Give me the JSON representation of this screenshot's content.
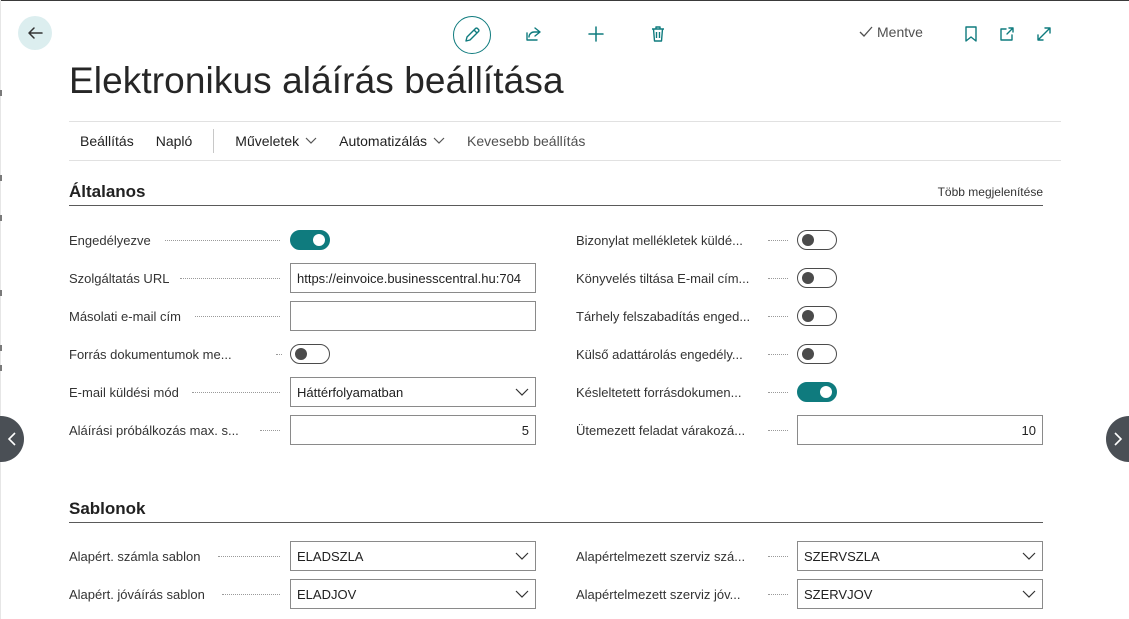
{
  "page": {
    "title": "Elektronikus aláírás beállítása"
  },
  "action_bar": {
    "saved_label": "Mentve",
    "icons": [
      "back-arrow-icon",
      "edit-pencil-icon",
      "share-icon",
      "plus-icon",
      "trash-icon",
      "checkmark-icon",
      "bookmark-icon",
      "open-new-window-icon",
      "expand-icon"
    ]
  },
  "menu": {
    "items": [
      {
        "label": "Beállítás"
      },
      {
        "label": "Napló"
      },
      {
        "label": "Műveletek"
      },
      {
        "label": "Automatizálás"
      },
      {
        "label": "Kevesebb beállítás"
      }
    ]
  },
  "general": {
    "title": "Általanos",
    "show_more": "Több megjelenítése",
    "left_fields": [
      {
        "label": "Engedélyezve",
        "type": "toggle",
        "value": true
      },
      {
        "label": "Szolgáltatás URL",
        "type": "text",
        "value": "https://einvoice.businesscentral.hu:704"
      },
      {
        "label": "Másolati e-mail cím",
        "type": "text",
        "value": ""
      },
      {
        "label": "Forrás dokumentumok me...",
        "type": "toggle",
        "value": false
      },
      {
        "label": "E-mail küldési mód",
        "type": "select",
        "value": "Háttérfolyamatban"
      },
      {
        "label": "Aláírási próbálkozás max. s...",
        "type": "number",
        "value": "5"
      }
    ],
    "right_fields": [
      {
        "label": "Bizonylat mellékletek küldé...",
        "type": "toggle",
        "value": false
      },
      {
        "label": "Könyvelés tiltása E-mail cím...",
        "type": "toggle",
        "value": false
      },
      {
        "label": "Tárhely felszabadítás enged...",
        "type": "toggle",
        "value": false
      },
      {
        "label": "Külső adattárolás engedély...",
        "type": "toggle",
        "value": false
      },
      {
        "label": "Késleltetett forrásdokumen...",
        "type": "toggle",
        "value": true
      },
      {
        "label": "Ütemezett feladat várakozá...",
        "type": "number",
        "value": "10"
      }
    ]
  },
  "templates": {
    "title": "Sablonok",
    "left_fields": [
      {
        "label": "Alapért. számla sablon",
        "type": "select",
        "value": "ELADSZLA"
      },
      {
        "label": "Alapért. jóváírás sablon",
        "type": "select",
        "value": "ELADJOV"
      }
    ],
    "right_fields": [
      {
        "label": "Alapértelmezett szerviz szá...",
        "type": "select",
        "value": "SZERVSZLA"
      },
      {
        "label": "Alapértelmezett szerviz jóv...",
        "type": "select",
        "value": "SZERVJOV"
      }
    ]
  },
  "colors": {
    "accent": "#0f7b7e",
    "toggle_off": "#4b4b4b",
    "nav_circle": "#4a4f55"
  }
}
